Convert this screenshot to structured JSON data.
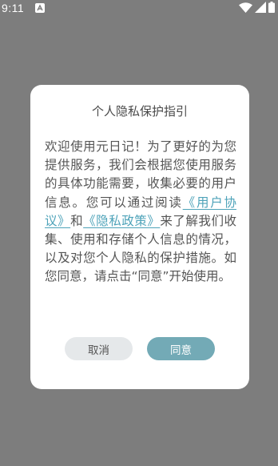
{
  "status_bar": {
    "time": "9:11",
    "icons": [
      "app-notification-icon",
      "wifi-icon",
      "cellular-signal-icon",
      "battery-icon"
    ]
  },
  "dialog": {
    "title": "个人隐私保护指引",
    "body_before": "欢迎使用元日记！为了更好的为您提供服务，我们会根据您使用服务的具体功能需要，收集必要的用户信息。您可以通过阅读",
    "link_user_agreement": "《用户协议》",
    "between_links": "和",
    "link_privacy_policy": "《隐私政策》",
    "body_after": "来了解我们收集、使用和存储个人信息的情况，以及对您个人隐私的保护措施。如您同意，请点击“同意”开始使用。",
    "cancel_label": "取消",
    "agree_label": "同意"
  },
  "colors": {
    "overlay": "#7d7d7d",
    "accent": "#73aab6",
    "link": "#4ea3b9",
    "cancel_bg": "#e5e8ea"
  }
}
